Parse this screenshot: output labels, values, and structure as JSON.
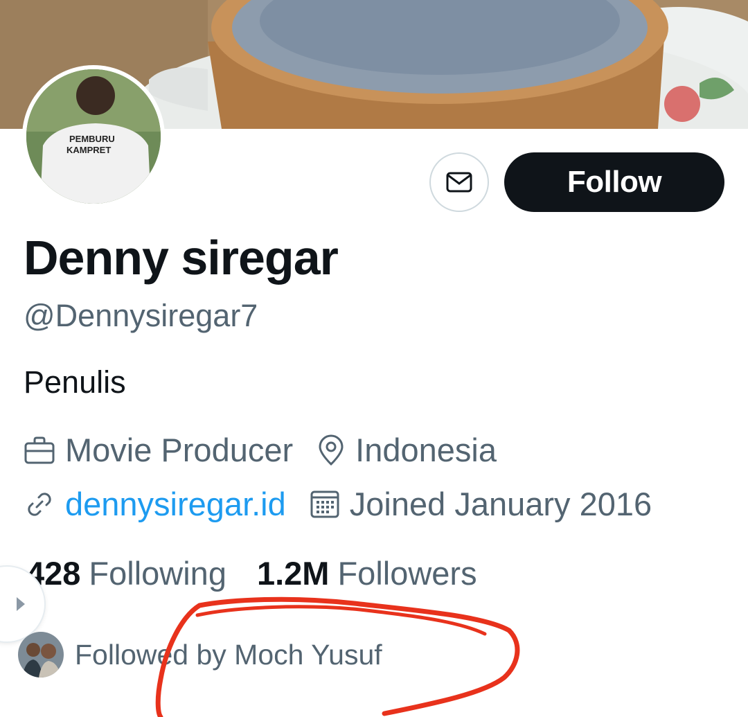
{
  "banner": {
    "alt": "coffee-cup-photo"
  },
  "avatar": {
    "shirt_text_line1": "PEMBURU",
    "shirt_text_line2": "KAMPRET"
  },
  "actions": {
    "message_icon": "envelope-icon",
    "follow_label": "Follow"
  },
  "profile": {
    "name": "Denny siregar",
    "handle": "@Dennysiregar7",
    "bio": "Penulis",
    "profession": "Movie Producer",
    "location": "Indonesia",
    "website": "dennysiregar.id",
    "joined": "Joined January 2016"
  },
  "stats": {
    "following_count": "428",
    "following_label": "Following",
    "followers_count": "1.2M",
    "followers_label": "Followers"
  },
  "followed_by": {
    "text": "Followed by Moch Yusuf"
  },
  "colors": {
    "text_primary": "#0f1419",
    "text_secondary": "#536471",
    "link": "#1d9bf0",
    "button_dark": "#0f1419",
    "annotation": "#e8321c"
  }
}
